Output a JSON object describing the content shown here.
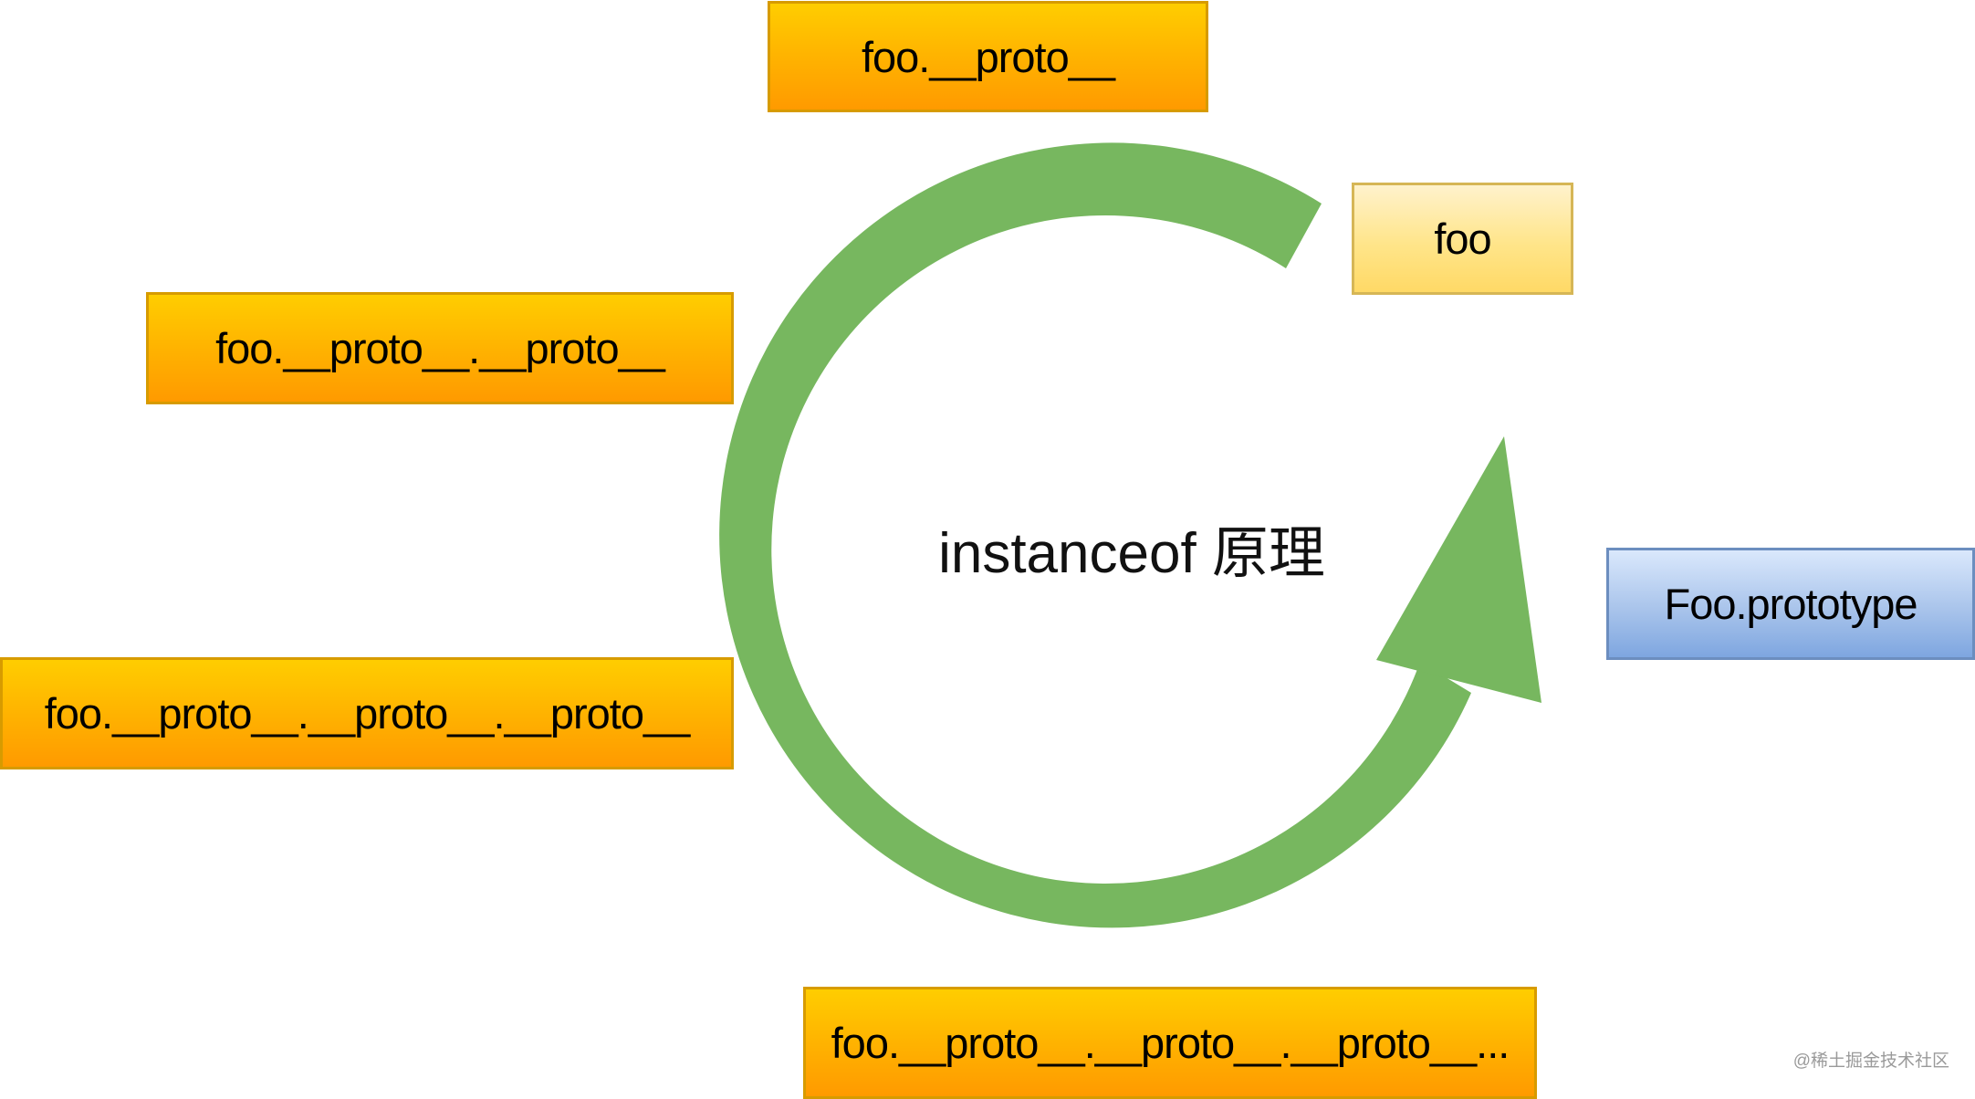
{
  "diagram": {
    "center_label": "instanceof 原理",
    "nodes": [
      {
        "id": "foo-proto-1",
        "label": "foo.__proto__",
        "style": "orange"
      },
      {
        "id": "foo",
        "label": "foo",
        "style": "yellow"
      },
      {
        "id": "foo-proto-2",
        "label": "foo.__proto__.__proto__",
        "style": "orange"
      },
      {
        "id": "foo-prototype",
        "label": "Foo.prototype",
        "style": "blue"
      },
      {
        "id": "foo-proto-3",
        "label": "foo.__proto__.__proto__.__proto__",
        "style": "orange"
      },
      {
        "id": "foo-proto-n",
        "label": "foo.__proto__.__proto__.__proto__...",
        "style": "orange"
      }
    ],
    "colors": {
      "arrow": "#77b75f",
      "orange_fill": "#ffb300",
      "orange_border": "#d79b00",
      "yellow_fill": "#ffe58a",
      "yellow_border": "#d6b656",
      "blue_fill": "#a9c4eb",
      "blue_border": "#6c8ebf"
    }
  },
  "watermark": "@稀土掘金技术社区"
}
